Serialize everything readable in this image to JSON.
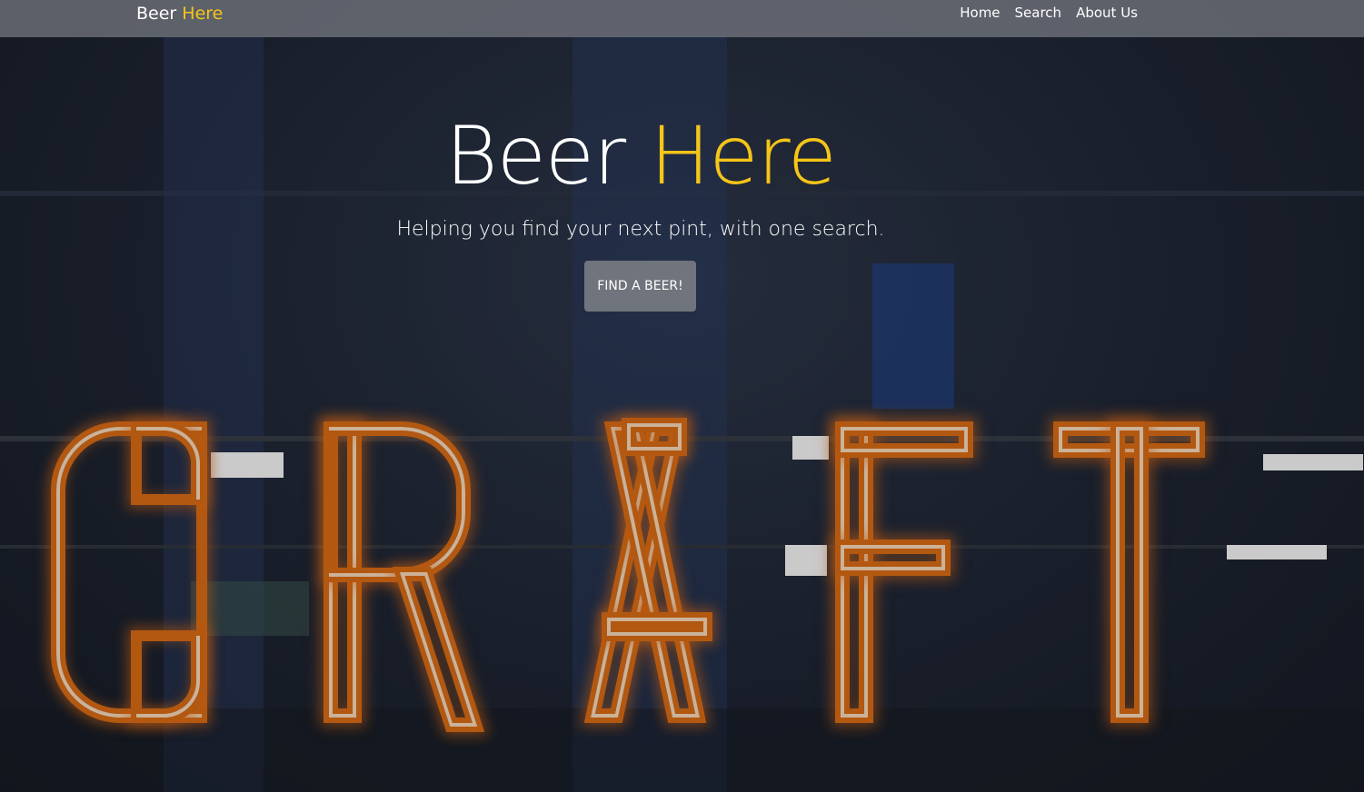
{
  "navbar": {
    "brand_main": "Beer",
    "brand_accent": "Here",
    "links": [
      {
        "label": "Home"
      },
      {
        "label": "Search"
      },
      {
        "label": "About Us"
      }
    ]
  },
  "hero": {
    "title_main": "Beer",
    "title_accent": "Here",
    "subtitle": "Helping you find your next pint, with one search.",
    "cta_label": "FIND A BEER!",
    "background_sign_text": "CRAFT"
  },
  "colors": {
    "accent": "#f5c518",
    "navbar_bg": "#787c84",
    "button_bg": "#70747c",
    "neon_orange": "#d86a12"
  }
}
